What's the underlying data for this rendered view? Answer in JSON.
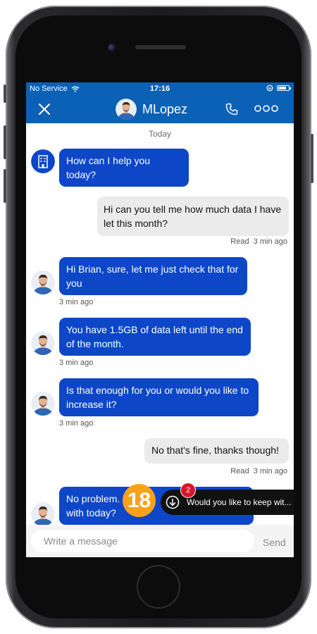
{
  "status_bar": {
    "carrier": "No Service",
    "time": "17:16",
    "battery_level": 0.8
  },
  "header": {
    "title": "MLopez"
  },
  "conversation": {
    "date_separator": "Today",
    "messages": [
      {
        "sender": "agent",
        "text": "How can I help you today?"
      },
      {
        "sender": "user",
        "text": "Hi can you tell me how much data I have let this month?",
        "read": "Read",
        "time": "3 min ago"
      },
      {
        "sender": "agent",
        "text": "Hi Brian, sure, let me just check that for you",
        "time": "3 min ago"
      },
      {
        "sender": "agent",
        "text": "You have 1.5GB of data left until the end of the month.",
        "time": "3 min ago"
      },
      {
        "sender": "agent",
        "text": "Is that enough for you or would you like to increase it?",
        "time": "3 min ago"
      },
      {
        "sender": "user",
        "text": "No that's fine, thanks though!",
        "read": "Read",
        "time": "3 min ago"
      },
      {
        "sender": "agent",
        "text": "No problem. with today?"
      }
    ]
  },
  "new_messages_toast": {
    "count": "2",
    "text": "Would you like to keep wit..."
  },
  "step_badge": "18",
  "composer": {
    "placeholder": "Write a message",
    "send_label": "Send"
  },
  "colors": {
    "brand_blue": "#0b61b6",
    "agent_bubble": "#0d47c8",
    "user_bubble": "#ebebeb",
    "badge_orange": "#f7a21a",
    "badge_red": "#d7182a"
  }
}
